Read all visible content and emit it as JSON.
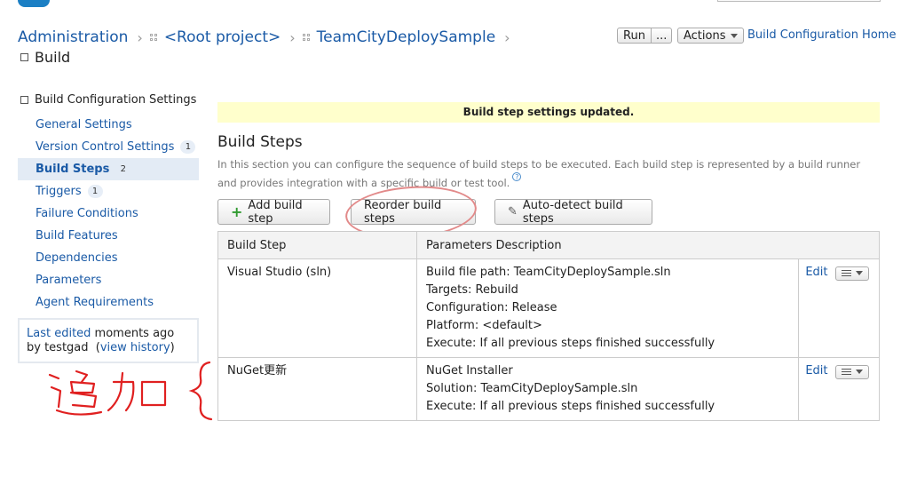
{
  "breadcrumb": {
    "items": [
      "Administration",
      "<Root project>",
      "TeamCityDeploySample"
    ],
    "page_title": "Build"
  },
  "toolbar_top": {
    "run_label": "Run",
    "run_more_label": "...",
    "actions_label": "Actions",
    "home_link": "Build Configuration Home"
  },
  "sidebar": {
    "header": "Build Configuration Settings",
    "items": [
      {
        "label": "General Settings",
        "badge": ""
      },
      {
        "label": "Version Control Settings",
        "badge": "1"
      },
      {
        "label": "Build Steps",
        "badge": "2"
      },
      {
        "label": "Triggers",
        "badge": "1"
      },
      {
        "label": "Failure Conditions",
        "badge": ""
      },
      {
        "label": "Build Features",
        "badge": ""
      },
      {
        "label": "Dependencies",
        "badge": ""
      },
      {
        "label": "Parameters",
        "badge": ""
      },
      {
        "label": "Agent Requirements",
        "badge": ""
      }
    ],
    "edited": {
      "link": "Last edited",
      "when": " moments ago",
      "by": "by testgad",
      "history_link": "view history"
    }
  },
  "notice": "Build step settings updated.",
  "section": {
    "title": "Build Steps",
    "description": "In this section you can configure the sequence of build steps to be executed. Each build step is represented by a build runner and provides integration with a specific build or test tool.",
    "help_glyph": "?"
  },
  "buttons": {
    "add": "Add build step",
    "reorder": "Reorder build steps",
    "autodetect": "Auto-detect build steps"
  },
  "table": {
    "headers": [
      "Build Step",
      "Parameters Description"
    ],
    "edit_label": "Edit",
    "rows": [
      {
        "step": "Visual Studio (sln)",
        "params": [
          "Build file path: TeamCityDeploySample.sln",
          "Targets: Rebuild",
          "Configuration: Release",
          "Platform: <default>",
          "Execute: If all previous steps finished successfully"
        ]
      },
      {
        "step": "NuGet更新",
        "params": [
          "NuGet Installer",
          "Solution: TeamCityDeploySample.sln",
          "Execute: If all previous steps finished successfully"
        ]
      }
    ]
  },
  "annotation": {
    "text": "追加",
    "color": "#e02020",
    "circle_color": "#e28a8a"
  },
  "colors": {
    "link": "#1a5aa6",
    "notice_bg": "#ffffcc",
    "active_bg": "#e3ebf5",
    "plus": "#2f9a2f"
  }
}
